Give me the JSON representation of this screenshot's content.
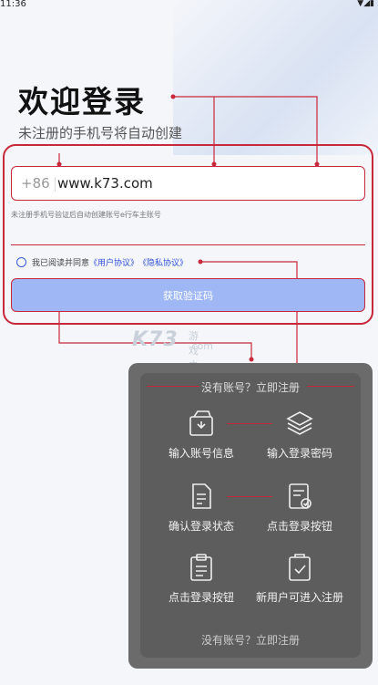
{
  "status": {
    "time": "11:36",
    "icons": "▼◢▮"
  },
  "header": {
    "title": "欢迎登录",
    "subtitle": "未注册的手机号将自动创建"
  },
  "login": {
    "country_code": "+86",
    "phone_value": "www.k73.com",
    "note": "未注册手机号验证后自动创建账号e行车主账号",
    "agree_prefix": "我已阅读并同意",
    "user_agreement": "《用户协议》",
    "privacy_agreement": "《隐私协议》",
    "get_code_button": "获取验证码"
  },
  "watermark": {
    "brand": "K73",
    "cn": "游戏之家",
    "domain": ".com"
  },
  "guide": {
    "header": "没有账号？立即注册",
    "footer": "没有账号？立即注册",
    "steps": [
      {
        "label": "输入账号信息",
        "icon": "wallet-icon"
      },
      {
        "label": "输入登录密码",
        "icon": "layers-icon"
      },
      {
        "label": "确认登录状态",
        "icon": "document-icon"
      },
      {
        "label": "点击登录按钮",
        "icon": "document-check-icon"
      },
      {
        "label": "点击登录按钮",
        "icon": "clipboard-icon"
      },
      {
        "label": "新用户可进入注册",
        "icon": "shield-check-icon"
      }
    ]
  },
  "colors": {
    "accent_red": "#c8283a",
    "link_blue": "#2f4fd6",
    "button_blue": "#9fb8f5",
    "card_bg": "#6b6b6b"
  }
}
